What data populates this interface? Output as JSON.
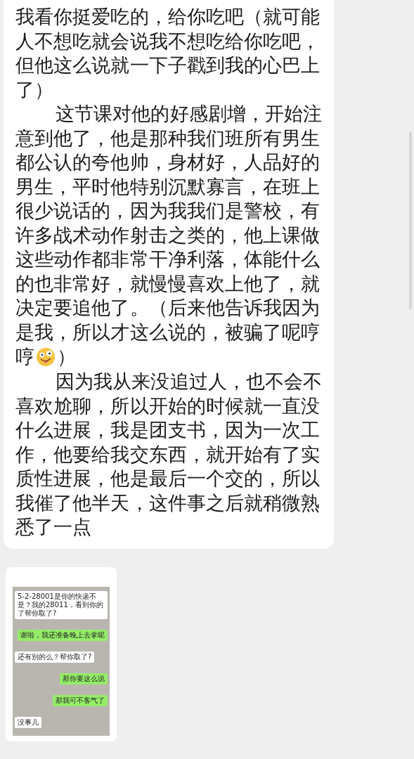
{
  "message": {
    "paragraphs": [
      {
        "text": "我看你挺爱吃的，给你吃吧（就可能人不想吃就会说我不想吃给你吃吧，但他这么说就一下子戳到我的心巴上了）",
        "indent": false
      },
      {
        "text": "这节课对他的好感剧增，开始注意到他了，他是那种我们班所有男生都公认的夸他帅，身材好，人品好的男生，平时他特别沉默寡言，在班上很少说话的，因为我我们是警校，有许多战术动作射击之类的，他上课做这些动作都非常干净利落，体能什么的也非常好，就慢慢喜欢上他了，就决定要追他了。（后来他告诉我因为是我，所以才这么说的，被骗了呢哼",
        "indent": true,
        "emoji_line": {
          "before": "哼",
          "after": "）"
        }
      },
      {
        "text": "因为我从来没追过人，也不会不喜欢尬聊，所以开始的时候就一直没什么进展，我是团支书，因为一次工作，他要给我交东西，就开始有了实质性进展，他是最后一个交的，所以我催了他半天，这件事之后就稍微熟悉了一点",
        "indent": true
      }
    ]
  },
  "image_message": {
    "bubbles": [
      {
        "text": "5-2-28001是你的快递不是？我的28011，看到你的了帮你取了?",
        "outgoing": false
      },
      {
        "text": "谢啦，我还准备晚上去拿呢",
        "outgoing": true
      },
      {
        "text": "还有别的么？帮你取了?",
        "outgoing": false
      },
      {
        "text": "那你要这么说",
        "outgoing": true
      },
      {
        "text": "那我可不客气了",
        "outgoing": true
      },
      {
        "text": "没事儿",
        "outgoing": false
      }
    ]
  }
}
